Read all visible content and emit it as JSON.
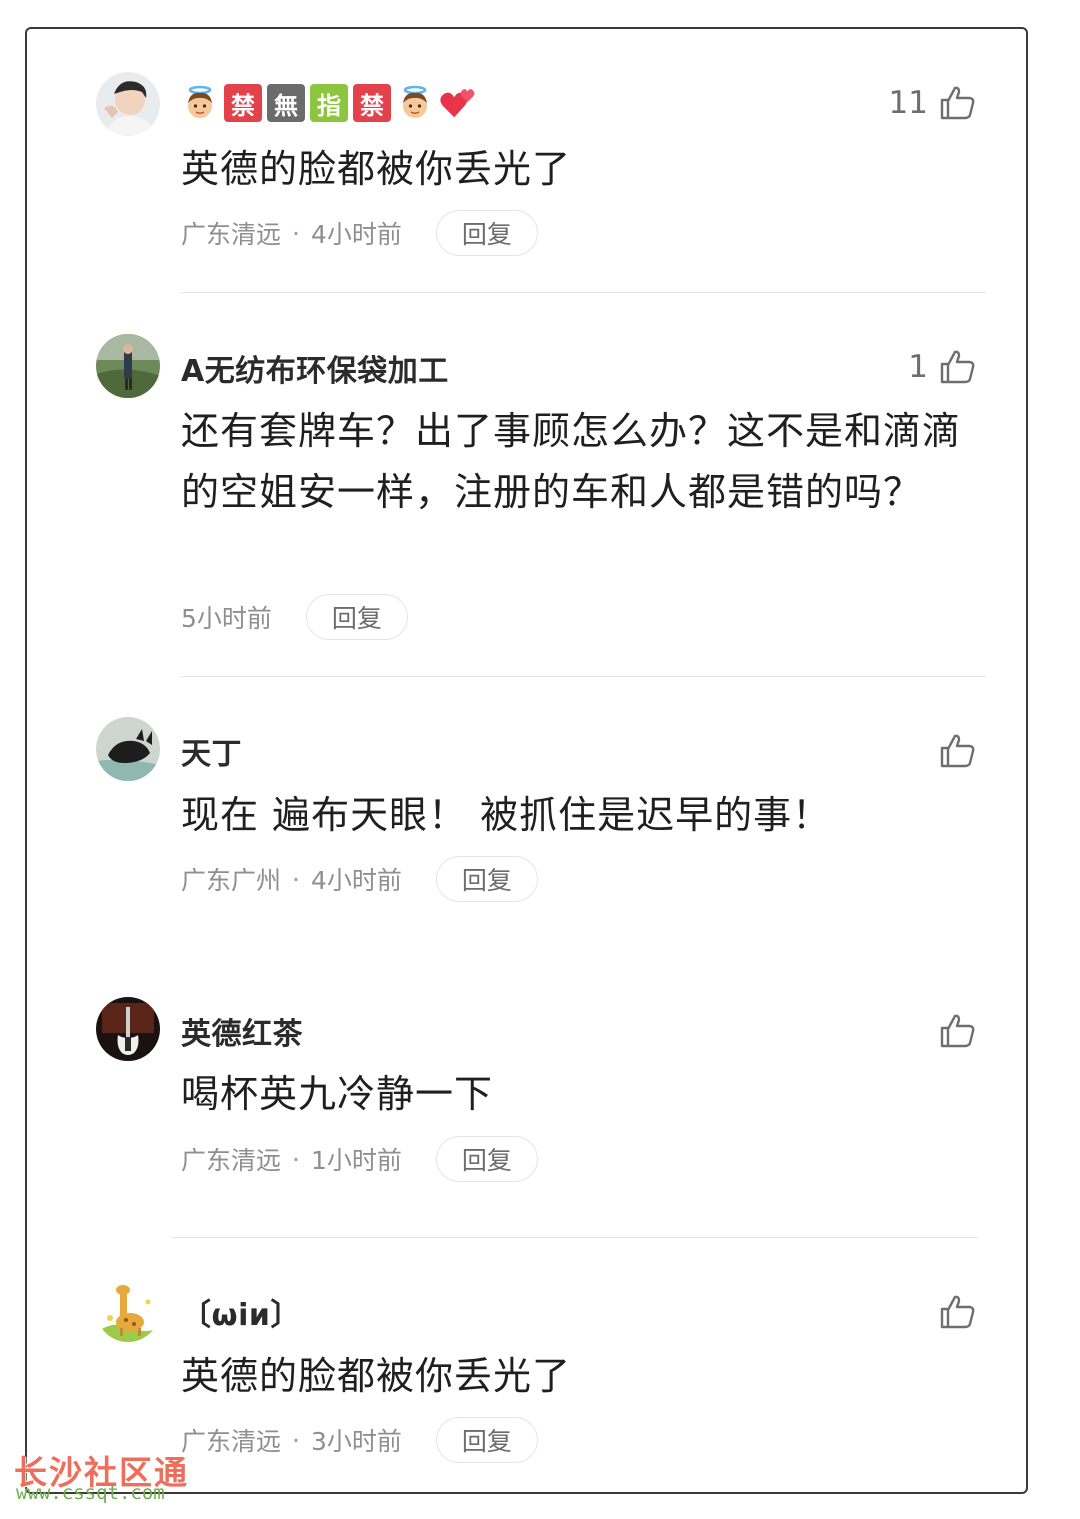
{
  "colors": {
    "text": "#1f1f1f",
    "meta": "#8f8f8f",
    "divider": "#e4e4e4",
    "watermark_red": "#ee6e5c",
    "watermark_green": "#6fae50"
  },
  "comments": [
    {
      "badges": [
        {
          "type": "emoji",
          "icon": "angel-emoji"
        },
        {
          "type": "tile",
          "text": "禁",
          "color": "#e2424a"
        },
        {
          "type": "tile",
          "text": "無",
          "color": "#6b6b6b"
        },
        {
          "type": "tile",
          "text": "指",
          "color": "#8cc63f"
        },
        {
          "type": "tile",
          "text": "禁",
          "color": "#e2424a"
        },
        {
          "type": "emoji",
          "icon": "angel-emoji"
        },
        {
          "type": "emoji",
          "icon": "two-hearts-emoji"
        }
      ],
      "likes": "11",
      "text": "英德的脸都被你丢光了",
      "location": "广东清远",
      "time": "4小时前",
      "reply_label": "回复"
    },
    {
      "username": "A无纺布环保袋加工",
      "likes": "1",
      "text": "还有套牌车？出了事顾怎么办？这不是和滴滴的空姐安一样，注册的车和人都是错的吗？",
      "time": "5小时前",
      "reply_label": "回复"
    },
    {
      "username": "天丁",
      "text": "现在 遍布天眼！ 被抓住是迟早的事！",
      "location": "广东广州",
      "time": "4小时前",
      "reply_label": "回复"
    },
    {
      "username": "英德红茶",
      "text": "喝杯英九冷静一下",
      "location": "广东清远",
      "time": "1小时前",
      "reply_label": "回复"
    },
    {
      "username": "〔ωiи〕",
      "text": "英德的脸都被你丢光了",
      "location": "广东清远",
      "time": "3小时前",
      "reply_label": "回复"
    }
  ],
  "separator": "·",
  "watermark": {
    "title": "长沙社区通",
    "url": "www.cssqt.com"
  }
}
